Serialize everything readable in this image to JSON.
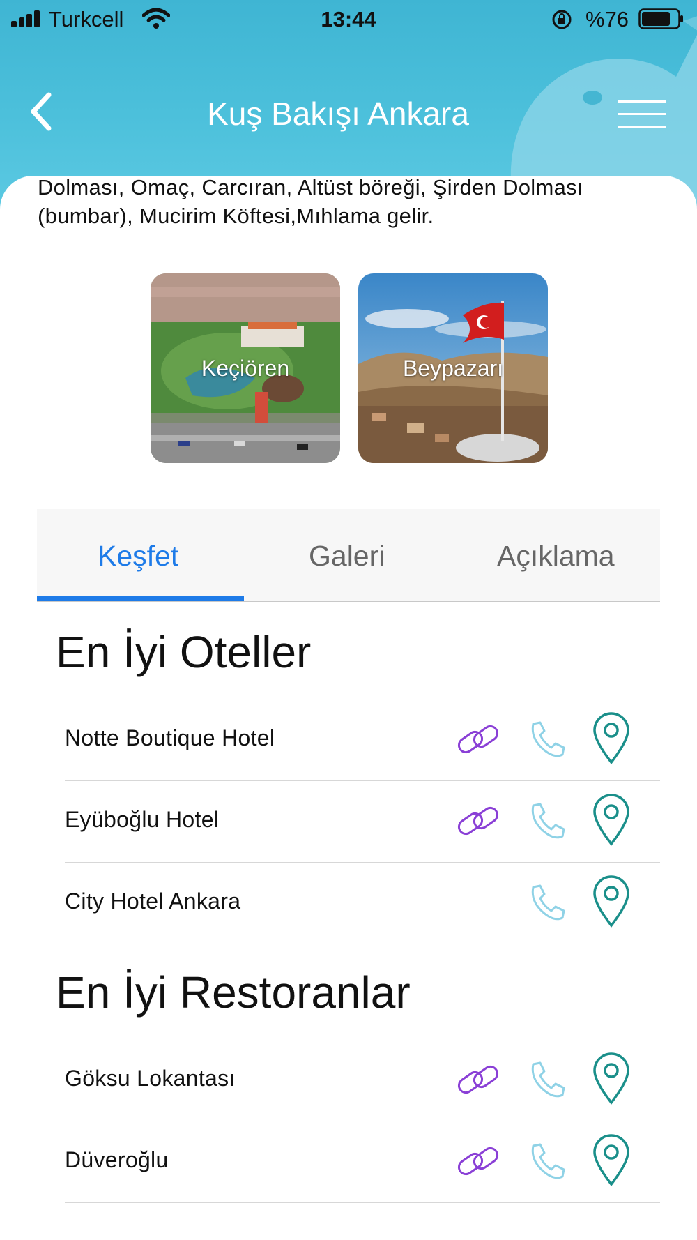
{
  "status_bar": {
    "carrier": "Turkcell",
    "time": "13:44",
    "battery": "%76"
  },
  "nav": {
    "title": "Kuş Bakışı Ankara"
  },
  "description": "Dolması, Omaç,  Carcıran, Altüst böreği, Şirden Dolması (bumbar), Mucirim Köftesi,Mıhlama gelir.",
  "cards": [
    {
      "label": "Keçiören"
    },
    {
      "label": "Beypazarı"
    }
  ],
  "tabs": [
    {
      "label": "Keşfet",
      "active": true
    },
    {
      "label": "Galeri",
      "active": false
    },
    {
      "label": "Açıklama",
      "active": false
    }
  ],
  "sections": [
    {
      "title": "En İyi Oteller",
      "items": [
        {
          "name": "Notte Boutique Hotel",
          "icons": [
            "link-icon",
            "phone-icon",
            "location-pin-icon"
          ]
        },
        {
          "name": "Eyüboğlu Hotel",
          "icons": [
            "link-icon",
            "phone-icon",
            "location-pin-icon"
          ]
        },
        {
          "name": "City Hotel Ankara",
          "icons": [
            "phone-icon",
            "location-pin-icon"
          ]
        }
      ]
    },
    {
      "title": "En İyi Restoranlar",
      "items": [
        {
          "name": "Göksu Lokantası",
          "icons": [
            "link-icon",
            "phone-icon",
            "location-pin-icon"
          ]
        },
        {
          "name": "Düveroğlu",
          "icons": [
            "link-icon",
            "phone-icon",
            "location-pin-icon"
          ]
        }
      ]
    }
  ],
  "colors": {
    "header": "#4cc0db",
    "tab_active": "#1e7be8",
    "link_icon": "#8a3fd6",
    "phone_icon": "#8fd2e6",
    "pin_icon": "#1a8f8a"
  }
}
